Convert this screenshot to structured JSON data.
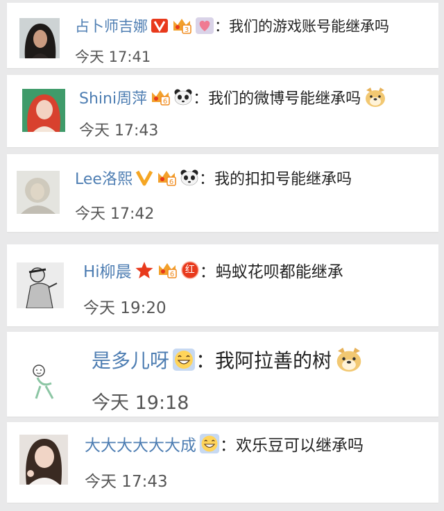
{
  "colors": {
    "name": "#4d7db2",
    "text": "#222222",
    "time": "#555555",
    "background": "#e9e9ea",
    "card": "#ffffff",
    "vip_orange": "#f08a1c",
    "vip_red": "#e8391c"
  },
  "comments": [
    {
      "name": "占卜师吉娜",
      "colon": "：",
      "text": "我们的游戏账号能继承吗",
      "time": "今天 17:41",
      "badges": [
        "verified-v-red-icon",
        "fan-crown-icon-level-3",
        "heart-badge-icon"
      ]
    },
    {
      "name": "Shini周萍",
      "colon": "：",
      "text": "我们的微博号能继承吗",
      "time": "今天 17:43",
      "badges": [
        "fan-crown-icon-level-6",
        "panda-emoji"
      ],
      "trailing_emoji": "doge-emoji"
    },
    {
      "name": "Lee洛熙",
      "colon": "：",
      "text": "我的扣扣号能继承吗",
      "time": "今天 17:42",
      "badges": [
        "verified-v-orange-icon",
        "fan-crown-icon-level-6",
        "panda-emoji"
      ]
    },
    {
      "name": "Hi柳晨",
      "colon": "：",
      "text": "蚂蚁花呗都能继承",
      "time": "今天 19:20",
      "badges": [
        "red-star-icon",
        "fan-crown-icon-level-6",
        "red-badge-icon"
      ],
      "red_badge_char": "红"
    },
    {
      "name": "是多儿呀",
      "colon": "：",
      "text": "我阿拉善的树",
      "time": "今天 19:18",
      "badges": [
        "grin-emoji"
      ],
      "trailing_emoji": "doge-emoji"
    },
    {
      "name": "大大大大大大成",
      "colon": "：",
      "text": "欢乐豆可以继承吗",
      "time": "今天 17:43",
      "badges": [
        "grin-emoji"
      ]
    }
  ]
}
